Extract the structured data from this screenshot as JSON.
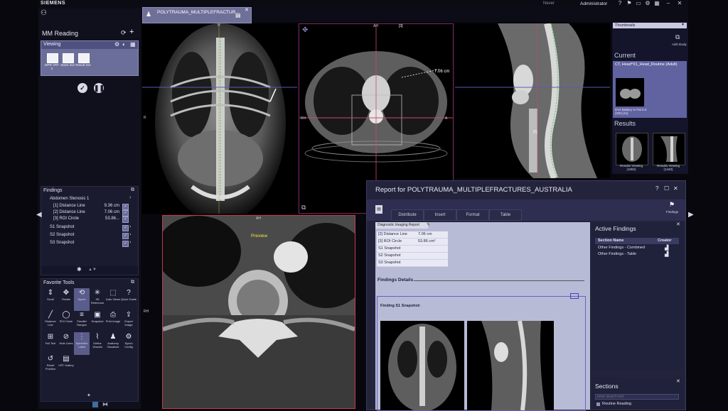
{
  "topbar": {
    "brand": "SIEMENS",
    "user_hint": "Never",
    "user": "Administrator",
    "icons": [
      "help-icon",
      "bookmark-icon",
      "monitor-icon",
      "gear-icon",
      "grid-icon",
      "minimize-icon",
      "close-icon"
    ]
  },
  "left": {
    "workflow_title": "MM Reading",
    "viewing": {
      "title": "Viewing",
      "buttons": [
        {
          "label": "MPR VRT 2"
        },
        {
          "label": "Stack 2x2"
        },
        {
          "label": "Result 2x2"
        }
      ]
    },
    "findings": {
      "title": "Findings",
      "group": "Abdomen Stenosis 1",
      "items": [
        {
          "label": "[1] Distance Line",
          "value": "9.36 cm"
        },
        {
          "label": "[2] Distance Line",
          "value": "7.06 cm"
        },
        {
          "label": "[3] ROI Circle",
          "value": "53.86..."
        }
      ],
      "snapshots": [
        "S1 Snapshot",
        "S2 Snapshot",
        "S3 Snapshot"
      ]
    },
    "favorite_tools": {
      "title": "Favorite Tools",
      "tools": [
        {
          "label": "Scroll",
          "icon": "scroll-icon",
          "glyph": "⇕"
        },
        {
          "label": "Rotate",
          "icon": "rotate-icon",
          "glyph": "✥"
        },
        {
          "label": "Synch",
          "icon": "synch-icon",
          "glyph": "⟲"
        },
        {
          "label": "3D Reference",
          "icon": "3d-reference-icon",
          "glyph": "✳"
        },
        {
          "label": "Auto Views",
          "icon": "auto-views-icon",
          "glyph": "⬚"
        },
        {
          "label": "Quick Guide",
          "icon": "quick-guide-icon",
          "glyph": "?"
        },
        {
          "label": "Distance Line",
          "icon": "distance-line-icon",
          "glyph": "╱"
        },
        {
          "label": "ROI Circle",
          "icon": "roi-circle-icon",
          "glyph": "◯"
        },
        {
          "label": "Parallel Ranges",
          "icon": "parallel-ranges-icon",
          "glyph": "≡"
        },
        {
          "label": "Snapshot",
          "icon": "camera-icon",
          "glyph": "▣"
        },
        {
          "label": "Print Image",
          "icon": "print-icon",
          "glyph": "⎙"
        },
        {
          "label": "Export Image",
          "icon": "export-icon",
          "glyph": "⇪"
        },
        {
          "label": "Full Text",
          "icon": "full-text-icon",
          "glyph": "⊞"
        },
        {
          "label": "Hide Lines",
          "icon": "hide-lines-icon",
          "glyph": "⊘"
        },
        {
          "label": "SpineWiz Label",
          "icon": "spine-label-icon",
          "glyph": "⋮"
        },
        {
          "label": "Define Vessels",
          "icon": "define-vessels-icon",
          "glyph": "⌇"
        },
        {
          "label": "Anatomy Visualizer",
          "icon": "anatomy-icon",
          "glyph": "♟"
        },
        {
          "label": "Synch Config",
          "icon": "synch-config-icon",
          "glyph": "⚙"
        },
        {
          "label": "Reset Position",
          "icon": "reset-icon",
          "glyph": "↺"
        },
        {
          "label": "VRT Gallery",
          "icon": "vrt-gallery-icon",
          "glyph": "▤"
        }
      ]
    }
  },
  "tab": {
    "title": "POLYTRAUMA_MULTIPLEFRACTUR..."
  },
  "viewers": {
    "axial_labels": {
      "top": "AH",
      "left": "RH",
      "right": "A"
    },
    "axial_measure": "7.06 cm",
    "axial_annot": "[3]",
    "coronal_labels": {
      "top": "H",
      "left": "R"
    },
    "sagittal_measure": "[1]",
    "zoom_label": "AH",
    "zoom_preview": "Preview",
    "zoom_left": "RH"
  },
  "right": {
    "dropdown": "Thumbnails",
    "add_study": "Add Study",
    "current_title": "Current",
    "current_series": "CT, Head^01_Head_Routine (Adult)",
    "current_thumb": "DVA Battery to Fat 5.0 (2DI) [11]",
    "results_title": "Results",
    "results_thumbs": [
      "Results Viewing (1082)",
      "Results Viewing (1440)"
    ]
  },
  "report": {
    "title": "Report for POLYTRAUMA_MULTIPLEFRACTURES_AUSTRALIA",
    "tabs": [
      "Distribute",
      "Insert",
      "Format",
      "Table"
    ],
    "findings_btn": "Findings",
    "doc_tab": "Diagnostic Imaging Report",
    "mini_table": [
      {
        "label": "[2] Distance Line",
        "value": "7.06 cm"
      },
      {
        "label": "[3] ROI Circle",
        "value": "53.86 cm²"
      },
      {
        "label": "S1 Snapshot",
        "value": ""
      },
      {
        "label": "S2 Snapshot",
        "value": ""
      },
      {
        "label": "S3 Snapshot",
        "value": ""
      }
    ],
    "findings_details": "Findings Details",
    "finding_s1": "Finding S1 Snapshot:",
    "active_findings": {
      "title": "Active Findings",
      "columns": [
        "Section Name",
        "Creator"
      ],
      "rows": [
        "Other Findings - Combined",
        "Other Findings - Table"
      ]
    },
    "sections": {
      "title": "Sections",
      "search_placeholder": "enter search text",
      "items": [
        "Routine Reading"
      ]
    }
  }
}
